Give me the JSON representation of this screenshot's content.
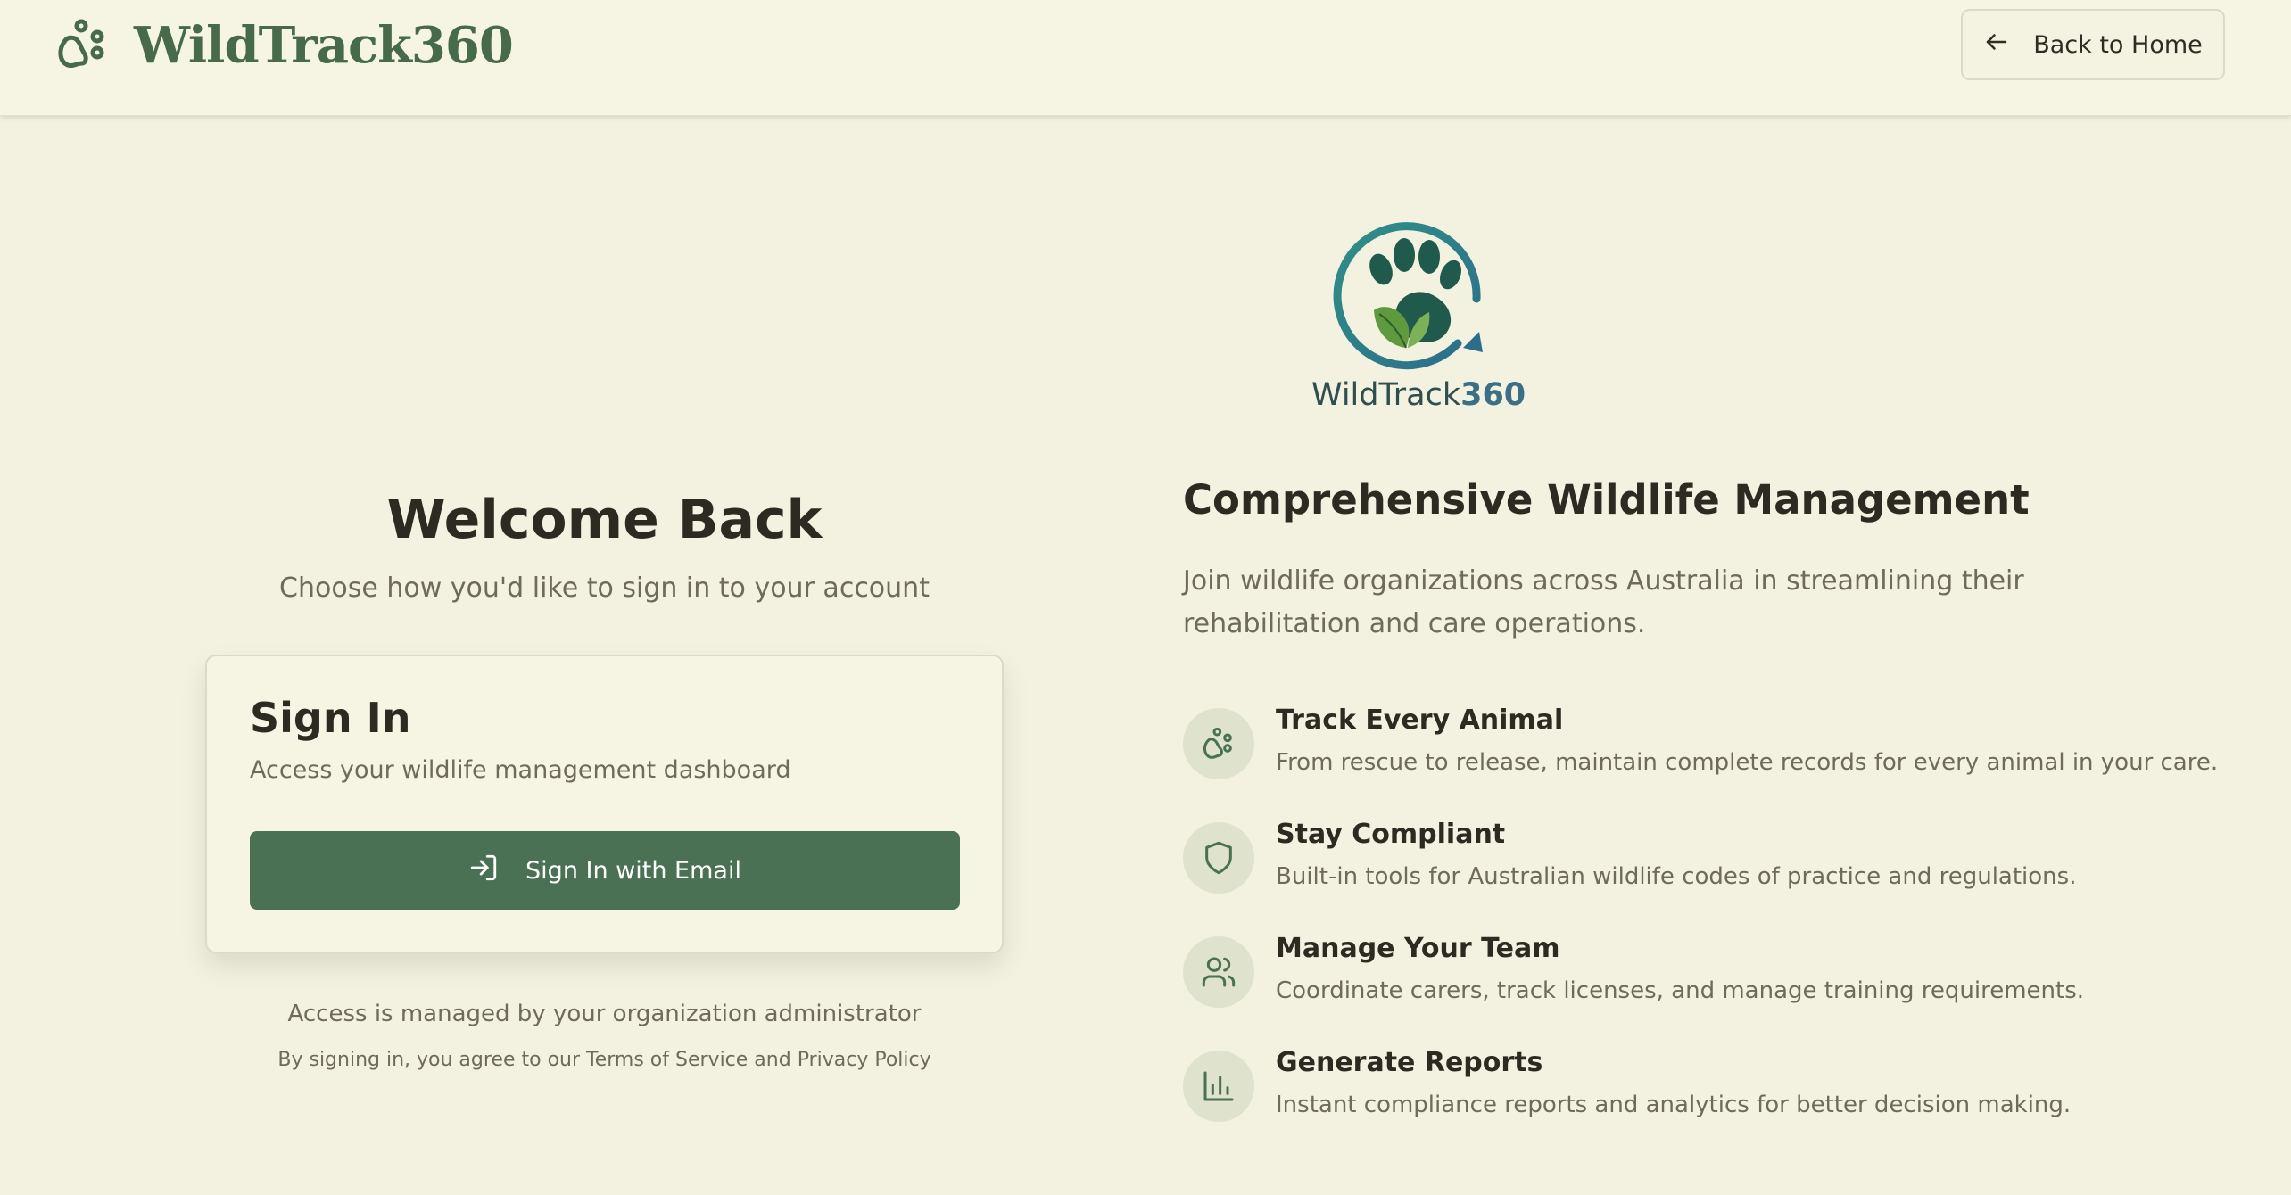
{
  "header": {
    "brand_name": "WildTrack360",
    "back_button_label": "Back to Home"
  },
  "signin": {
    "welcome_title": "Welcome Back",
    "welcome_subtitle": "Choose how you'd like to sign in to your account",
    "card_title": "Sign In",
    "card_subtitle": "Access your wildlife management dashboard",
    "email_button_label": "Sign In with Email",
    "access_note": "Access is managed by your organization administrator",
    "terms_note": "By signing in, you agree to our Terms of Service and Privacy Policy"
  },
  "info": {
    "logo_text_main": "WildTrack",
    "logo_text_num": "360",
    "title": "Comprehensive Wildlife Management",
    "description": "Join wildlife organizations across Australia in streamlining their rehabilitation and care operations.",
    "features": [
      {
        "icon": "paw-icon",
        "title": "Track Every Animal",
        "description": "From rescue to release, maintain complete records for every animal in your care."
      },
      {
        "icon": "shield-icon",
        "title": "Stay Compliant",
        "description": "Built-in tools for Australian wildlife codes of practice and regulations."
      },
      {
        "icon": "users-icon",
        "title": "Manage Your Team",
        "description": "Coordinate carers, track licenses, and manage training requirements."
      },
      {
        "icon": "bar-chart-icon",
        "title": "Generate Reports",
        "description": "Instant compliance reports and analytics for better decision making."
      }
    ]
  },
  "colors": {
    "background": "#f3f1df",
    "header_bg": "#f6f5e3",
    "primary_green": "#4a7153",
    "brand_green": "#466a4a",
    "teal_accent": "#3a6f86",
    "text_dark": "#2d2a22",
    "text_muted": "#6f6a5b"
  }
}
